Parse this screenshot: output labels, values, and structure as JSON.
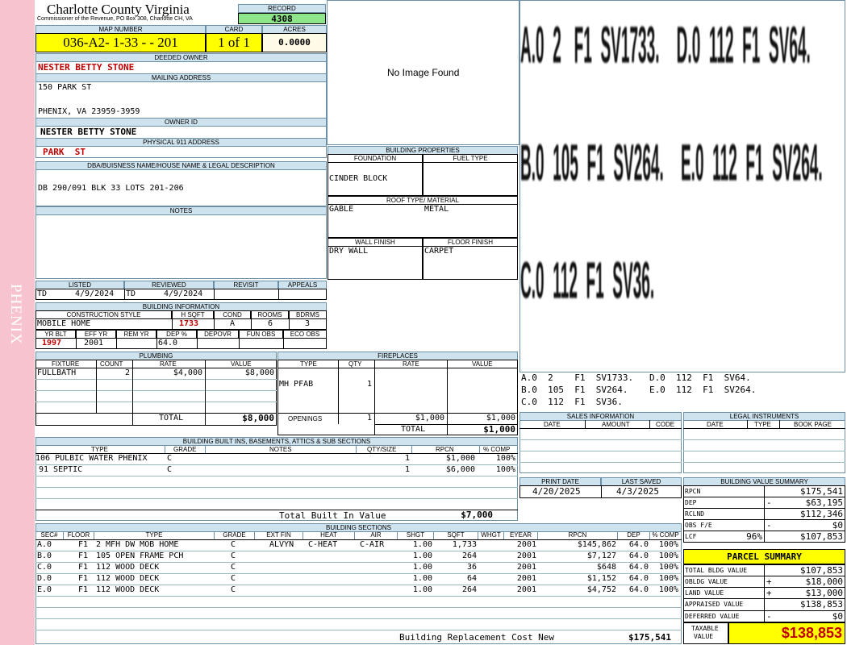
{
  "side_label": "PHENIX",
  "header": {
    "title": "Charlotte County Virginia",
    "subtitle": "Commissioner of the Revenue, PO Box 308, Charlotte CH, VA",
    "record_label": "RECORD",
    "record_value": "4308"
  },
  "map": {
    "map_number_label": "MAP NUMBER",
    "map_number": "036-A2- 1-33 -  - 201",
    "card_label": "CARD",
    "card": "1 of 1",
    "acres_label": "ACRES",
    "acres": "0.0000"
  },
  "owner": {
    "deeded_owner_label": "DEEDED OWNER",
    "deeded_owner": "NESTER BETTY STONE",
    "mailing_label": "MAILING ADDRESS",
    "mailing_line1": "150 PARK ST",
    "mailing_line2": "PHENIX, VA 23959-3959",
    "owner_id_label": "OWNER ID",
    "owner_id": "NESTER BETTY STONE",
    "physical_label": "PHYSICAL 911 ADDRESS",
    "physical": "PARK  ST"
  },
  "legal": {
    "label": "DBA/BUISNESS NAME/HOUSE NAME & LEGAL DESCRIPTION",
    "text": "DB 290/091 BLK 33 LOTS 201-206"
  },
  "notes": {
    "label": "NOTES"
  },
  "image": {
    "placeholder": "No Image Found"
  },
  "listing": {
    "listed_label": "LISTED",
    "reviewed_label": "REVIEWED",
    "revisit_label": "REVISIT",
    "appeals_label": "APPEALS",
    "listed_by": "TD",
    "listed_date": "4/9/2024",
    "reviewed_by": "TD",
    "reviewed_date": "4/9/2024"
  },
  "building_info": {
    "label": "BUILDING INFORMATION",
    "h_construction": "CONSTRUCTION STYLE",
    "h_hsqft": "H SQFT",
    "h_cond": "COND",
    "h_rooms": "ROOMS",
    "h_bdrms": "BDRMS",
    "construction": "MOBILE HOME",
    "hsqft": "1733",
    "cond": "A",
    "rooms": "6",
    "bdrms": "3",
    "h_yrblt": "YR BLT",
    "h_effyr": "EFF YR",
    "h_remyr": "REM YR",
    "h_dep": "DEP %",
    "h_depovr": "DEPOVR",
    "h_funobs": "FUN OBS",
    "h_ecoobs": "ECO OBS",
    "yrblt": "1997",
    "effyr": "2001",
    "dep": "64.0"
  },
  "building_props": {
    "label": "BUILDING PROPERTIES",
    "foundation_label": "FOUNDATION",
    "fuel_label": "FUEL TYPE",
    "foundation": "CINDER BLOCK",
    "roof_label": "ROOF TYPE/ MATERIAL",
    "roof_type": "GABLE",
    "roof_material": "METAL",
    "wall_label": "WALL FINISH",
    "floor_label": "FLOOR FINISH",
    "wall": "DRY WALL",
    "floor": "CARPET"
  },
  "sketch": {
    "big_lines": [
      "A.0  2   F1  SV1733.    D.0  112  F1  SV64.",
      "B.0  105  F1  SV264.    E.0  112  F1  SV264.",
      "C.0  112  F1  SV36."
    ],
    "small_lines": [
      "A.0  2    F1  SV1733.   D.0  112  F1  SV64.",
      "B.0  105  F1  SV264.    E.0  112  F1  SV264.",
      "C.0  112  F1  SV36."
    ]
  },
  "plumbing": {
    "label": "PLUMBING",
    "headers": [
      "FIXTURE",
      "COUNT",
      "RATE",
      "VALUE"
    ],
    "rows": [
      [
        "FULLBATH",
        "2",
        "$4,000",
        "$8,000"
      ]
    ],
    "total_label": "TOTAL",
    "total": "$8,000"
  },
  "fireplaces": {
    "label": "FIREPLACES",
    "headers": [
      "TYPE",
      "QTY",
      "RATE",
      "VALUE"
    ],
    "rows": [
      [
        "MH PFAB",
        "1",
        "",
        ""
      ]
    ],
    "openings_label": "OPENINGS",
    "openings_qty": "1",
    "openings_rate": "$1,000",
    "openings_value": "$1,000",
    "total_label": "TOTAL",
    "total": "$1,000"
  },
  "builtins": {
    "label": "BUILDING BUILT INS, BASEMENTS, ATTICS & SUB SECTIONS",
    "headers": [
      "TYPE",
      "GRADE",
      "NOTES",
      "QTY/SIZE",
      "RPCN",
      "% COMP"
    ],
    "rows": [
      [
        "106 PULBIC WATER PHENIX",
        "C",
        "",
        "1",
        "$1,000",
        "100%"
      ],
      [
        "91 SEPTIC",
        "C",
        "",
        "1",
        "$6,000",
        "100%"
      ]
    ],
    "total_label": "Total Built In Value",
    "total": "$7,000"
  },
  "sales": {
    "label": "SALES INFORMATION",
    "headers": [
      "DATE",
      "AMOUNT",
      "CODE"
    ]
  },
  "legal_instruments": {
    "label": "LEGAL INSTRUMENTS",
    "headers": [
      "DATE",
      "TYPE",
      "BOOK PAGE"
    ]
  },
  "print": {
    "print_label": "PRINT DATE",
    "saved_label": "LAST SAVED",
    "print_date": "4/20/2025",
    "saved_date": "4/3/2025"
  },
  "value_summary": {
    "label": "BUILDING VALUE SUMMARY",
    "rows": [
      {
        "k": "RPCN",
        "sign": "",
        "v": "$175,541"
      },
      {
        "k": "DEP",
        "sign": "-",
        "v": "$63,195"
      },
      {
        "k": "RCLND",
        "sign": "",
        "v": "$112,346"
      },
      {
        "k": "OBS F/E",
        "sign": "-",
        "v": "$0"
      },
      {
        "k": "LCF",
        "pct": "96%",
        "sign": "",
        "v": "$107,853"
      }
    ]
  },
  "parcel": {
    "label": "PARCEL SUMMARY",
    "rows": [
      {
        "k": "TOTAL BLDG VALUE",
        "sign": "",
        "v": "$107,853"
      },
      {
        "k": "OBLDG VALUE",
        "sign": "+",
        "v": "$18,000"
      },
      {
        "k": "LAND VALUE",
        "sign": "+",
        "v": "$13,000"
      },
      {
        "k": "APPRAISED VALUE",
        "sign": "",
        "v": "$138,853"
      },
      {
        "k": "DEFERRED VALUE",
        "sign": "-",
        "v": "$0"
      }
    ],
    "taxable_label_1": "TAXABLE",
    "taxable_label_2": "VALUE",
    "taxable": "$138,853"
  },
  "sections": {
    "label": "BUILDING SECTIONS",
    "headers": [
      "SEC#",
      "FLOOR",
      "TYPE",
      "GRADE",
      "EXT FIN",
      "HEAT",
      "AIR",
      "SHGT",
      "SQFT",
      "WHGT",
      "EYEAR",
      "RPCN",
      "DEP",
      "% COMP"
    ],
    "rows": [
      [
        "A.0",
        "F1",
        "2 MFH DW MOB HOME",
        "C",
        "ALVYN",
        "C-HEAT",
        "C-AIR",
        "1.00",
        "1,733",
        "",
        "2001",
        "$145,862",
        "64.0",
        "100%"
      ],
      [
        "B.0",
        "F1",
        "105 OPEN FRAME PCH",
        "C",
        "",
        "",
        "",
        "1.00",
        "264",
        "",
        "2001",
        "$7,127",
        "64.0",
        "100%"
      ],
      [
        "C.0",
        "F1",
        "112 WOOD DECK",
        "C",
        "",
        "",
        "",
        "1.00",
        "36",
        "",
        "2001",
        "$648",
        "64.0",
        "100%"
      ],
      [
        "D.0",
        "F1",
        "112 WOOD DECK",
        "C",
        "",
        "",
        "",
        "1.00",
        "64",
        "",
        "2001",
        "$1,152",
        "64.0",
        "100%"
      ],
      [
        "E.0",
        "F1",
        "112 WOOD DECK",
        "C",
        "",
        "",
        "",
        "1.00",
        "264",
        "",
        "2001",
        "$4,752",
        "64.0",
        "100%"
      ]
    ],
    "total_label": "Building Replacement Cost New",
    "total": "$175,541"
  },
  "colors": {
    "pink": "#f7c3ce",
    "header_blue": "#cfe3ee",
    "yellow": "#ffff00",
    "green": "#8ee58a",
    "red": "#c00000"
  }
}
